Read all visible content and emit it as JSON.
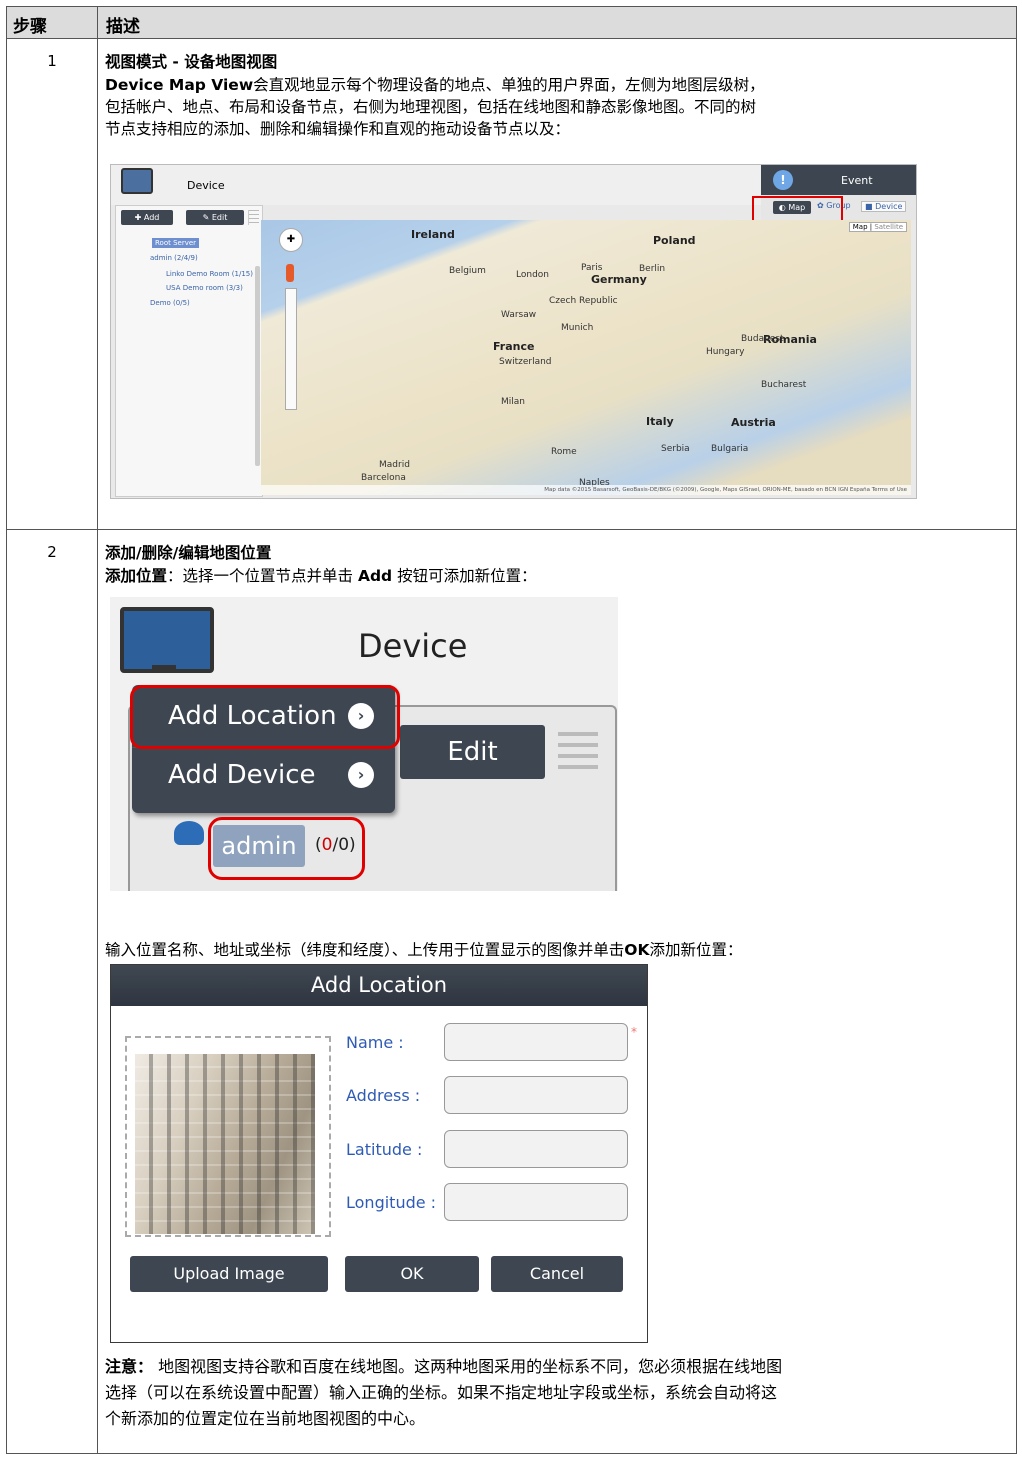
{
  "header": {
    "col_step": "步骤",
    "col_desc": "描述"
  },
  "step1": {
    "number": "1",
    "title": "视图模式 - 设备地图视图",
    "desc_bold": "Device Map View",
    "desc_l1": "会直观地显示每个物理设备的地点、单独的用户界面，左侧为地图层级树，",
    "desc_l2": "包括帐户、地点、布局和设备节点，右侧为地理视图，包括在线地图和静态影像地图。不同的树",
    "desc_l3": "节点支持相应的添加、删除和编辑操作和直观的拖动设备节点以及：",
    "screenshot": {
      "device": "Device",
      "event": "Event",
      "add": "Add",
      "edit": "Edit",
      "map_btn": "Map",
      "group_btn": "Group",
      "device_btn": "Device",
      "map_tab": "Map",
      "satellite_tab": "Satellite",
      "tree": [
        "Root Server",
        "admin (2/4/9)",
        "Linko Demo Room (1/15)",
        "USA Demo room (3/3)",
        "Demo (0/5)"
      ],
      "places": [
        "Ireland",
        "Poland",
        "Germany",
        "France",
        "Italy",
        "Romania",
        "Hungary",
        "Austria",
        "Bulgaria",
        "Serbia",
        "Belgium",
        "Czech Republic",
        "London",
        "Berlin",
        "Paris",
        "Warsaw",
        "Munich",
        "Switzerland",
        "Barcelona",
        "Madrid",
        "Milan",
        "Rome",
        "Naples",
        "Budapest",
        "Bucharest"
      ],
      "footer": "Map data ©2015 Basarsoft, GeoBasis-DE/BKG (©2009), Google, Maps GISrael, ORION-ME, basado en BCN IGN España   Terms of Use"
    }
  },
  "step2": {
    "number": "2",
    "title": "添加/删除/编辑地图位置",
    "line1_bold": "添加位置",
    "line1_a": "：选择一个位置节点并单击 ",
    "line1_add": "Add",
    "line1_b": " 按钮可添加新位置：",
    "menu": {
      "device": "Device",
      "add_location": "Add Location",
      "add_device": "Add Device",
      "edit": "Edit",
      "admin": "admin",
      "count_open": "(",
      "count_red": "0",
      "count_rest": "/0)"
    },
    "line2_a": "输入位置名称、地址或坐标（纬度和经度）、上传用于位置显示的图像并单击",
    "line2_ok": "OK",
    "line2_b": "添加新位置：",
    "dialog": {
      "title": "Add Location",
      "name": "Name :",
      "address": "Address :",
      "latitude": "Latitude :",
      "longitude": "Longitude :",
      "upload": "Upload Image",
      "ok": "OK",
      "cancel": "Cancel",
      "required": "*"
    },
    "note_bold": "注意：",
    "note_l1": " 地图视图支持谷歌和百度在线地图。这两种地图采用的坐标系不同，您必须根据在线地图",
    "note_l2": "选择（可以在系统设置中配置）输入正确的坐标。如果不指定地址字段或坐标，系统会自动将这",
    "note_l3": "个新添加的位置定位在当前地图视图的中心。"
  },
  "colors": {
    "header_bg": "#dcdcdc",
    "button_dark": "#3e4651",
    "highlight_red": "#e00000",
    "label_blue": "#2f5bb5"
  }
}
